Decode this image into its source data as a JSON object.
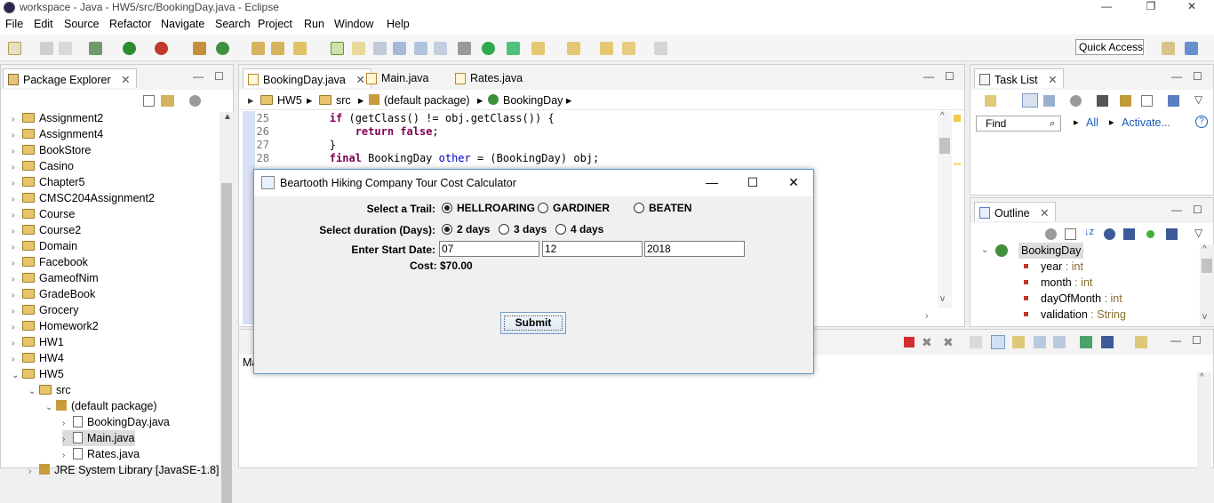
{
  "window": {
    "title": "workspace - Java - HW5/src/BookingDay.java - Eclipse"
  },
  "menu": [
    "File",
    "Edit",
    "Source",
    "Refactor",
    "Navigate",
    "Search",
    "Project",
    "Run",
    "Window",
    "Help"
  ],
  "toolbar": {
    "quick_access": "Quick Access"
  },
  "package_explorer": {
    "title": "Package Explorer",
    "items": [
      {
        "label": "Assignment2",
        "depth": 0,
        "kind": "project",
        "arrow": "›"
      },
      {
        "label": "Assignment4",
        "depth": 0,
        "kind": "project",
        "arrow": "›"
      },
      {
        "label": "BookStore",
        "depth": 0,
        "kind": "project",
        "arrow": "›"
      },
      {
        "label": "Casino",
        "depth": 0,
        "kind": "project",
        "arrow": "›"
      },
      {
        "label": "Chapter5",
        "depth": 0,
        "kind": "project",
        "arrow": "›"
      },
      {
        "label": "CMSC204Assignment2",
        "depth": 0,
        "kind": "project",
        "arrow": "›"
      },
      {
        "label": "Course",
        "depth": 0,
        "kind": "project",
        "arrow": "›"
      },
      {
        "label": "Course2",
        "depth": 0,
        "kind": "project",
        "arrow": "›"
      },
      {
        "label": "Domain",
        "depth": 0,
        "kind": "project",
        "arrow": "›"
      },
      {
        "label": "Facebook",
        "depth": 0,
        "kind": "project",
        "arrow": "›"
      },
      {
        "label": "GameofNim",
        "depth": 0,
        "kind": "project",
        "arrow": "›"
      },
      {
        "label": "GradeBook",
        "depth": 0,
        "kind": "project",
        "arrow": "›"
      },
      {
        "label": "Grocery",
        "depth": 0,
        "kind": "project",
        "arrow": "›"
      },
      {
        "label": "Homework2",
        "depth": 0,
        "kind": "project",
        "arrow": "›"
      },
      {
        "label": "HW1",
        "depth": 0,
        "kind": "project",
        "arrow": "›"
      },
      {
        "label": "HW4",
        "depth": 0,
        "kind": "project",
        "arrow": "›"
      },
      {
        "label": "HW5",
        "depth": 0,
        "kind": "project",
        "arrow": "⌄"
      },
      {
        "label": "src",
        "depth": 1,
        "kind": "project",
        "arrow": "⌄"
      },
      {
        "label": "(default package)",
        "depth": 2,
        "kind": "package",
        "arrow": "⌄"
      },
      {
        "label": "BookingDay.java",
        "depth": 3,
        "kind": "file",
        "arrow": "›"
      },
      {
        "label": "Main.java",
        "depth": 3,
        "kind": "file",
        "arrow": "›",
        "selected": true
      },
      {
        "label": "Rates.java",
        "depth": 3,
        "kind": "file",
        "arrow": "›"
      },
      {
        "label": "JRE System Library [JavaSE-1.8]",
        "depth": 1,
        "kind": "package",
        "arrow": "›"
      }
    ]
  },
  "editor": {
    "tabs": [
      {
        "label": "BookingDay.java",
        "close": "✕"
      },
      {
        "label": "Main.java"
      },
      {
        "label": "Rates.java"
      }
    ],
    "breadcrumb": [
      "HW5",
      "src",
      "(default package)",
      "BookingDay"
    ],
    "lines": [
      {
        "num": "25",
        "code": "        if (getClass() != obj.getClass()) {"
      },
      {
        "num": "26",
        "code": "            return false;"
      },
      {
        "num": "27",
        "code": "        }"
      },
      {
        "num": "28",
        "code": "        final BookingDay other = (BookingDay) obj;"
      }
    ]
  },
  "task_list": {
    "title": "Task List",
    "find": "Find",
    "all": "All",
    "activate": "Activate..."
  },
  "outline": {
    "title": "Outline",
    "root": "BookingDay",
    "fields": [
      {
        "name": "year",
        "type": " : int"
      },
      {
        "name": "month",
        "type": " : int"
      },
      {
        "name": "dayOfMonth",
        "type": " : int"
      },
      {
        "name": "validation",
        "type": " : String"
      }
    ]
  },
  "console": {
    "tab_label": "Ma"
  },
  "dialog": {
    "title": "Beartooth Hiking Company Tour Cost Calculator",
    "trail_label": "Select a Trail:",
    "trails": [
      "HELLROARING",
      "GARDINER",
      "BEATEN"
    ],
    "trail_selected": 0,
    "duration_label": "Select duration (Days):",
    "durations": [
      "2 days",
      "3 days",
      "4 days"
    ],
    "duration_selected": 0,
    "start_date_label": "Enter Start Date:",
    "month_value": "07",
    "day_value": "12",
    "year_value": "2018",
    "cost_text": "Cost: $70.00",
    "submit_label": "Submit"
  }
}
